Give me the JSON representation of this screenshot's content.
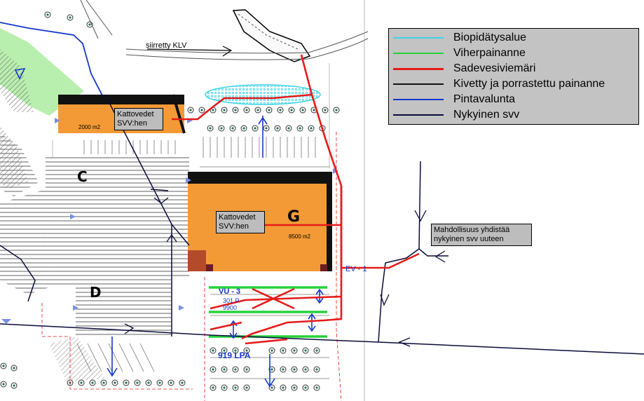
{
  "map": {
    "labels": {
      "klv_label": "siirretty KLV",
      "building_c": "C",
      "building_d": "D",
      "building_g": "G",
      "area_small": "2000 m2",
      "area_g": "8500 m2",
      "ev_label": "EV - 1",
      "vu_label": "VU - 3",
      "lpa_label": "919 LPA",
      "parking_p": "301 P",
      "parking_num": "9900"
    },
    "notes": {
      "roof_note_left_line1": "Kattovedet",
      "roof_note_left_line2": "SVV:hen",
      "roof_note_g_line1": "Kattovedet",
      "roof_note_g_line2": "SVV:hen",
      "connect_note_line1": "Mahdollisuus yhdistää",
      "connect_note_line2": "nykyinen svv uuteen"
    }
  },
  "legend": {
    "items": [
      {
        "label": "Biopidätysalue",
        "color": "#3ed4e6"
      },
      {
        "label": "Viherpainanne",
        "color": "#27d23a"
      },
      {
        "label": "Sadevesiviemäri",
        "color": "#e51b1b"
      },
      {
        "label": "Kivetty ja porrastettu painanne",
        "color": "#111111"
      },
      {
        "label": "Pintavalunta",
        "color": "#1537c9"
      },
      {
        "label": "Nykyinen svv",
        "color": "#0b0b3a"
      }
    ]
  }
}
